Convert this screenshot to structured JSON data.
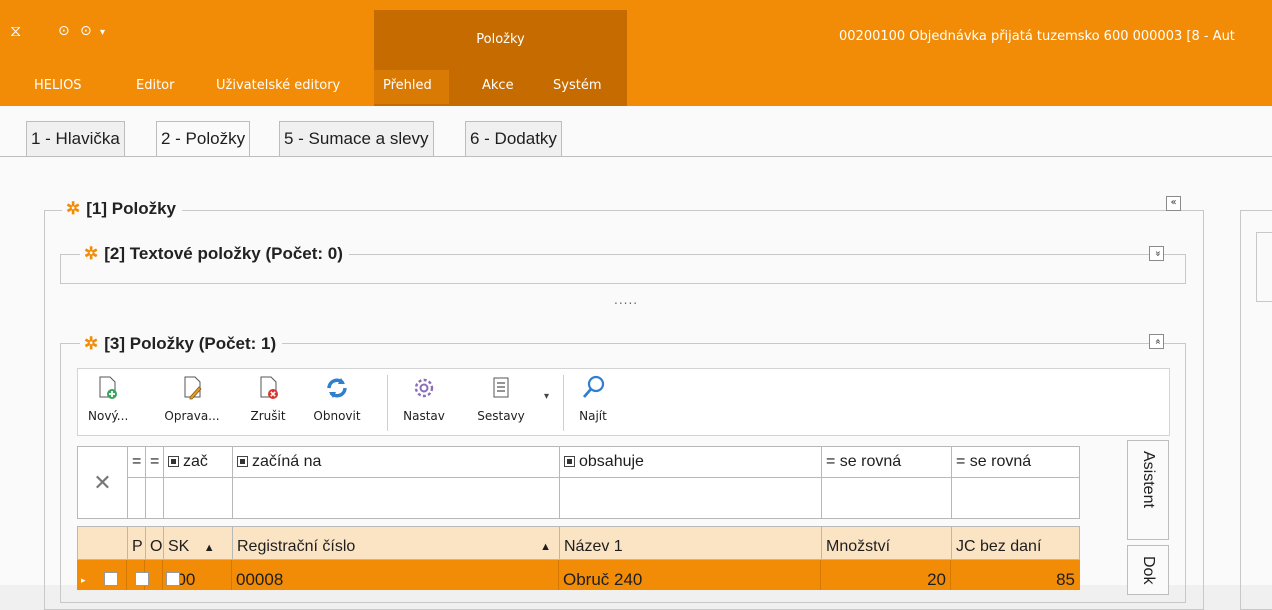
{
  "ribbon": {
    "quick_access": [
      "⧖",
      "⊙",
      "⊙",
      "▾"
    ],
    "context_group_title": "Položky",
    "window_title": "00200100  Objednávka přijatá tuzemsko  600 000003 [8 - Aut",
    "tabs": [
      "HELIOS",
      "Editor",
      "Uživatelské editory",
      "Přehled",
      "Akce",
      "Systém"
    ],
    "accent_color": "#f28c06"
  },
  "page_tabs": [
    "1 - Hlavička",
    "2 - Položky",
    "5 - Sumace a slevy",
    "6 - Dodatky"
  ],
  "groups": {
    "g1": {
      "title": "[1] Položky",
      "button": "«"
    },
    "g2": {
      "title": "[2] Textové položky (Počet: 0)",
      "button": "»"
    },
    "g3": {
      "title": "[3] Položky (Počet: 1)",
      "button": "«"
    },
    "splitter": "....."
  },
  "toolbar": {
    "new_label": "Nový...",
    "edit_label": "Oprava...",
    "cancel_label": "Zrušit",
    "refresh_label": "Obnovit",
    "settings_label": "Nastav",
    "reports_label": "Sestavy",
    "find_label": "Najít",
    "dropdown": "▾"
  },
  "filter": {
    "clear": "✕",
    "cells": [
      "=",
      "=",
      "zač",
      "začíná na",
      "obsahuje",
      "= se rovná",
      "= se rovná"
    ]
  },
  "grid": {
    "columns": [
      "P",
      "O",
      "SK",
      "▲",
      "Registrační číslo",
      "▲",
      "Název 1",
      "Množství",
      "JC bez daní"
    ],
    "rows": [
      {
        "sk": "300",
        "reg_cislo": "00008",
        "nazev": "Obruč 240",
        "mnozstvi": "20",
        "jc": "85"
      }
    ]
  },
  "side_tabs": [
    "Asistent",
    "Dok"
  ]
}
